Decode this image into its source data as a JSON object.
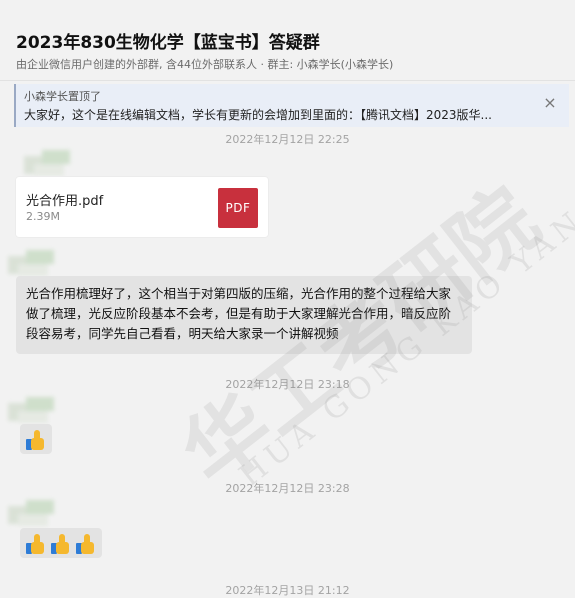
{
  "header": {
    "title": "2023年830生物化学【蓝宝书】答疑群",
    "subtitle": "由企业微信用户创建的外部群, 含44位外部联系人 · 群主: 小森学长(小森学长)"
  },
  "pinned": {
    "by": "小森学长置顶了",
    "text": "大家好，这个是在线编辑文档，学长有更新的会增加到里面的：【腾讯文档】2023版华...",
    "close_icon": "×"
  },
  "messages": {
    "ts1": "2022年12月12日 22:25",
    "file_name": "光合作用.pdf",
    "file_size": "2.39M",
    "file_icon_label": "PDF",
    "text_message": "光合作用梳理好了，这个相当于对第四版的压缩，光合作用的整个过程给大家做了梳理，光反应阶段基本不会考，但是有助于大家理解光合作用，暗反应阶段容易考，同学先自己看看，明天给大家录一个讲解视频",
    "ts2": "2022年12月12日 23:18",
    "ts3": "2022年12月12日 23:28",
    "ts4": "2022年12月13日 21:12"
  },
  "watermark": {
    "cn": "华工考研院",
    "en": "HUA GONG KAO YAN YUAN"
  },
  "colors": {
    "background": "#f2f2f2",
    "bubble": "#e3e3e3",
    "pdf": "#c8303d",
    "pinned_bg": "#e9eef7"
  }
}
